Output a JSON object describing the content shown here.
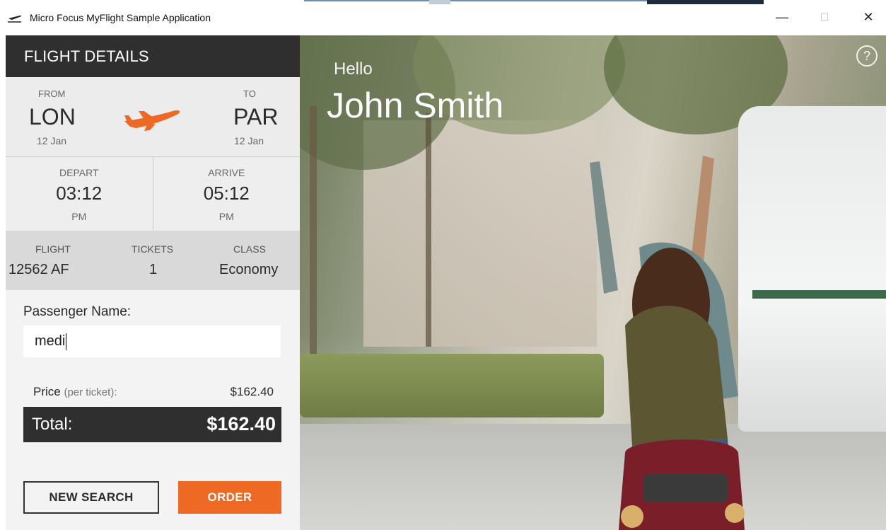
{
  "window": {
    "title": "Micro Focus MyFlight Sample Application",
    "minimize_glyph": "—",
    "maximize_glyph": "☐",
    "close_glyph": "✕"
  },
  "panel": {
    "header": "FLIGHT DETAILS",
    "route": {
      "from_label": "FROM",
      "from_code": "LON",
      "from_date": "12 Jan",
      "to_label": "TO",
      "to_code": "PAR",
      "to_date": "12 Jan"
    },
    "times": {
      "depart_label": "DEPART",
      "depart_time": "03:12",
      "depart_ampm": "PM",
      "arrive_label": "ARRIVE",
      "arrive_time": "05:12",
      "arrive_ampm": "PM"
    },
    "flight": {
      "flight_label": "FLIGHT",
      "flight_value": "12562 AF",
      "tickets_label": "TICKETS",
      "tickets_value": "1",
      "class_label": "CLASS",
      "class_value": "Economy"
    },
    "passenger": {
      "label": "Passenger Name:",
      "value": "medi"
    },
    "price": {
      "label": "Price",
      "sublabel": "(per ticket):",
      "amount": "$162.40"
    },
    "total": {
      "label": "Total:",
      "amount": "$162.40"
    },
    "buttons": {
      "new_search": "NEW SEARCH",
      "order": "ORDER"
    }
  },
  "hero": {
    "greeting": "Hello",
    "user_name": "John Smith",
    "help_glyph": "?"
  },
  "colors": {
    "accent": "#ee6a24",
    "header_dark": "#2f2f2f",
    "panel_bg": "#f3f3f3"
  }
}
